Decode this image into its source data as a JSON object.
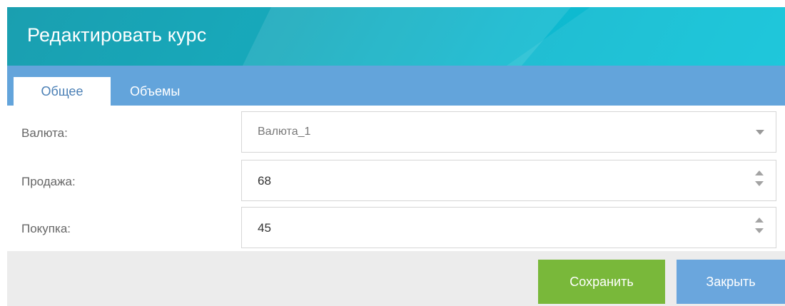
{
  "dialog": {
    "title": "Редактировать курс",
    "header_color": "#17a9bb"
  },
  "tabs": [
    {
      "label": "Общее",
      "active": true
    },
    {
      "label": "Объемы",
      "active": false
    }
  ],
  "form": {
    "currency": {
      "label": "Валюта:",
      "value": "Валюта_1"
    },
    "sell": {
      "label": "Продажа:",
      "value": "68"
    },
    "buy": {
      "label": "Покупка:",
      "value": "45"
    }
  },
  "footer": {
    "save_label": "Сохранить",
    "close_label": "Закрыть",
    "save_color": "#79b83a",
    "close_color": "#6aa6dd"
  },
  "icons": {
    "dropdown": "chevron-down-icon",
    "spinner": "spinner-arrows-icon"
  }
}
